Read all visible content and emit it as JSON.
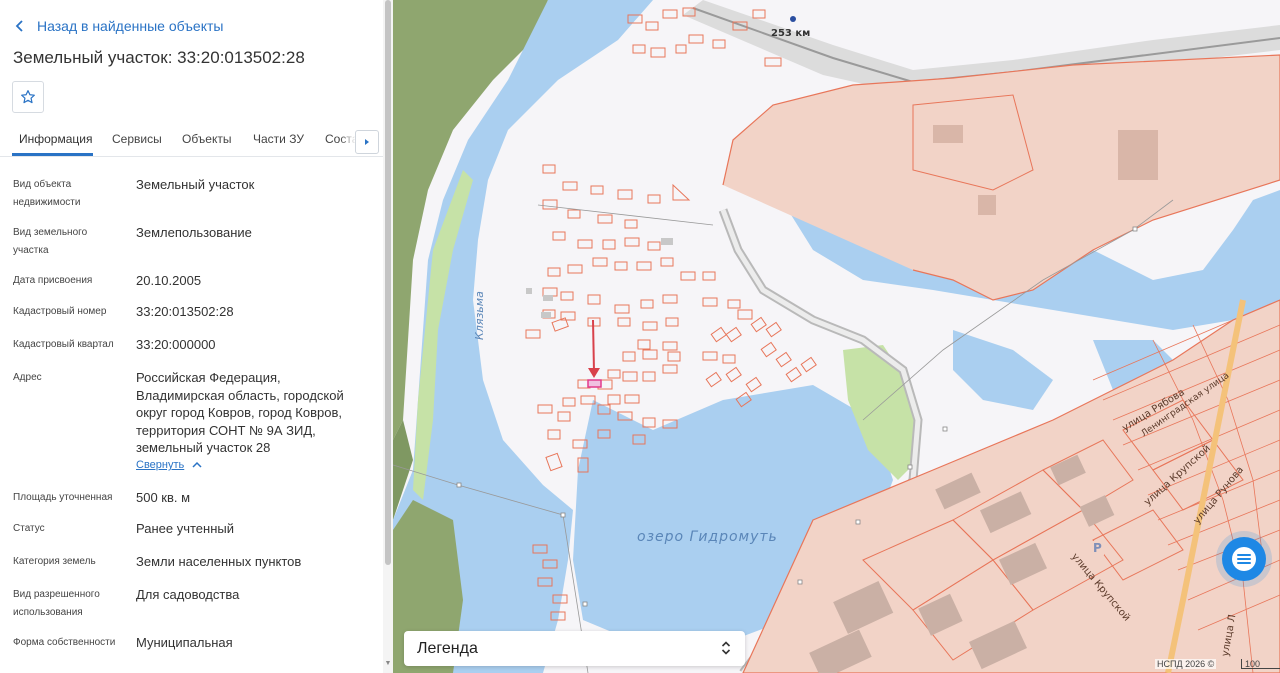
{
  "panel": {
    "back_label": "Назад в найденные объекты",
    "title": "Земельный участок: 33:20:013502:28",
    "tabs": [
      {
        "label": "Информация"
      },
      {
        "label": "Сервисы"
      },
      {
        "label": "Объекты"
      },
      {
        "label": "Части ЗУ"
      },
      {
        "label": "Соста"
      }
    ],
    "fields": [
      {
        "label": "Вид объекта недвижимости",
        "value": "Земельный участок"
      },
      {
        "label": "Вид земельного участка",
        "value": "Землепользование"
      },
      {
        "label": "Дата присвоения",
        "value": "20.10.2005"
      },
      {
        "label": "Кадастровый номер",
        "value": "33:20:013502:28"
      },
      {
        "label": "Кадастровый квартал",
        "value": "33:20:000000"
      },
      {
        "label": "Адрес",
        "value": "Российская Федерация, Владимирская область, городской округ город Ковров, город Ковров, территория СОНТ № 9А ЗИД, земельный участок 28"
      },
      {
        "label": "Площадь уточненная",
        "value": "500 кв. м"
      },
      {
        "label": "Статус",
        "value": "Ранее учтенный"
      },
      {
        "label": "Категория земель",
        "value": "Земли населенных пунктов"
      },
      {
        "label": "Вид разрешенного использования",
        "value": "Для садоводства"
      },
      {
        "label": "Форма собственности",
        "value": "Муниципальная"
      }
    ],
    "collapse_label": "Свернуть"
  },
  "map": {
    "labels": {
      "river": "Клязьма",
      "lake": "озеро Гидромуть",
      "km": "253 км",
      "street_ryabova": "улица Рябова",
      "street_leningradskaya": "Ленинградская улица",
      "street_krupskoy": "улица Крупской",
      "street_krupskoy2": "улица Крупской",
      "street_rynok": "улица Рунова",
      "street_lenina": "улица Л",
      "parking": "P"
    },
    "legend_label": "Легенда",
    "copyright": "НСПД 2026 ©",
    "scale": "100",
    "colors": {
      "water": "#aacff0",
      "parcel_line": "#e8765a",
      "parcel_fill": "#f2d3c7",
      "forest": "#8fa66f",
      "green": "#c6e2a7",
      "selected": "#e23a8c",
      "accent": "#2a73c5"
    }
  }
}
